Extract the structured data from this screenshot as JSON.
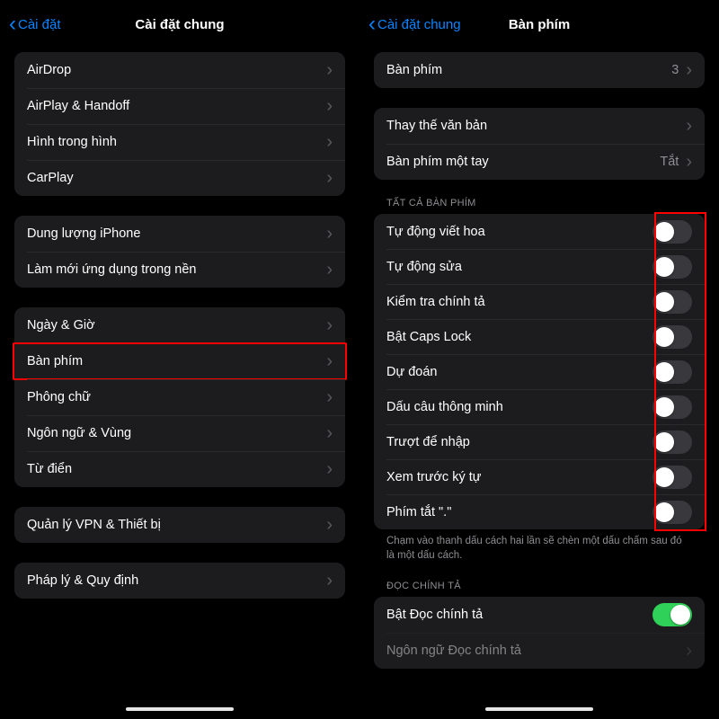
{
  "left": {
    "back": "Cài đặt",
    "title": "Cài đặt chung",
    "g1": [
      "AirDrop",
      "AirPlay & Handoff",
      "Hình trong hình",
      "CarPlay"
    ],
    "g2": [
      "Dung lượng iPhone",
      "Làm mới ứng dụng trong nền"
    ],
    "g3": [
      "Ngày & Giờ",
      "Bàn phím",
      "Phông chữ",
      "Ngôn ngữ & Vùng",
      "Từ điển"
    ],
    "g4": [
      "Quản lý VPN & Thiết bị"
    ],
    "g5": [
      "Pháp lý & Quy định"
    ]
  },
  "right": {
    "back": "Cài đặt chung",
    "title": "Bàn phím",
    "keyboards_label": "Bàn phím",
    "keyboards_count": "3",
    "text_replace": "Thay thế văn bản",
    "one_hand": "Bàn phím một tay",
    "one_hand_value": "Tắt",
    "section_all": "TẤT CẢ BÀN PHÍM",
    "toggles": [
      "Tự động viết hoa",
      "Tự động sửa",
      "Kiểm tra chính tả",
      "Bật Caps Lock",
      "Dự đoán",
      "Dấu câu thông minh",
      "Trượt để nhập",
      "Xem trước ký tự",
      "Phím tắt \".\""
    ],
    "footer": "Chạm vào thanh dấu cách hai lần sẽ chèn một dấu chấm sau đó là một dấu cách.",
    "section_dict": "ĐỌC CHÍNH TẢ",
    "dict_toggle": "Bật Đọc chính tả",
    "dict_languages": "Ngôn ngữ Đọc chính tả"
  },
  "colors": {
    "accent": "#0a84ff",
    "green": "#30d158",
    "highlight": "#ff0000"
  }
}
